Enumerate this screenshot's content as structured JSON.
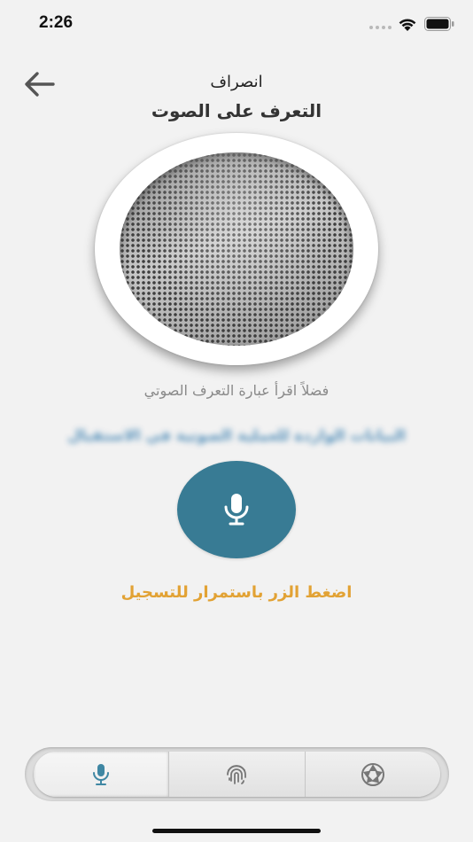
{
  "status_bar": {
    "time": "2:26"
  },
  "header": {
    "cancel_label": "انصراف",
    "title": "التعرف على الصوت"
  },
  "main": {
    "instruction": "فضلاً اقرأ عبارة التعرف الصوتي",
    "phrase": "البيانات الواردة للعملية الصوتية في الاستقبال",
    "hint": "اضغط الزر باستمرار للتسجيل"
  },
  "tabbar": {
    "tabs": [
      {
        "icon": "microphone-icon",
        "active": true
      },
      {
        "icon": "fingerprint-icon",
        "active": false
      },
      {
        "icon": "camera-shutter-icon",
        "active": false
      }
    ]
  },
  "colors": {
    "accent": "#387b94",
    "hint": "#e2a234",
    "background": "#f2f2f2"
  }
}
